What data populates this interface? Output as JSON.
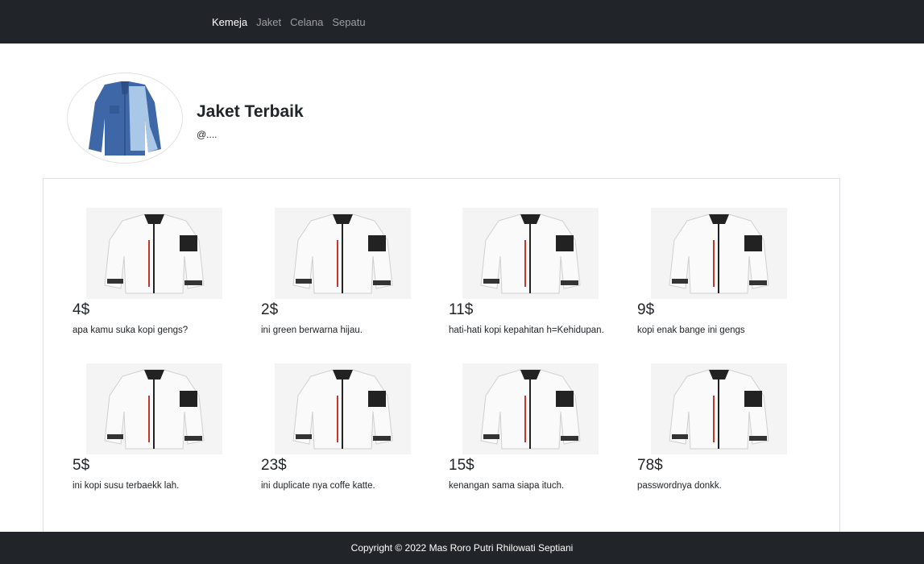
{
  "navbar": {
    "links": [
      {
        "label": "Kemeja",
        "active": true
      },
      {
        "label": "Jaket",
        "active": false
      },
      {
        "label": "Celana",
        "active": false
      },
      {
        "label": "Sepatu",
        "active": false
      }
    ]
  },
  "profile": {
    "title": "Jaket Terbaik",
    "handle": "@...."
  },
  "products": [
    {
      "price": "4$",
      "description": "apa kamu suka kopi gengs?"
    },
    {
      "price": "2$",
      "description": "ini green berwarna hijau."
    },
    {
      "price": "11$",
      "description": "hati-hati kopi kepahitan h=Kehidupan."
    },
    {
      "price": "9$",
      "description": "kopi enak bange ini gengs"
    },
    {
      "price": "5$",
      "description": "ini kopi susu terbaekk lah."
    },
    {
      "price": "23$",
      "description": "ini duplicate nya coffe katte."
    },
    {
      "price": "15$",
      "description": "kenangan sama siapa ituch."
    },
    {
      "price": "78$",
      "description": "passwordnya donkk."
    }
  ],
  "footer": {
    "text": "Copyright © 2022 Mas Roro Putri Rhilowati Septiani"
  },
  "colors": {
    "navbar_bg": "#212529",
    "footer_bg": "#212529",
    "denim": "#3d67a6",
    "jacket_white": "#f2f2f2"
  }
}
